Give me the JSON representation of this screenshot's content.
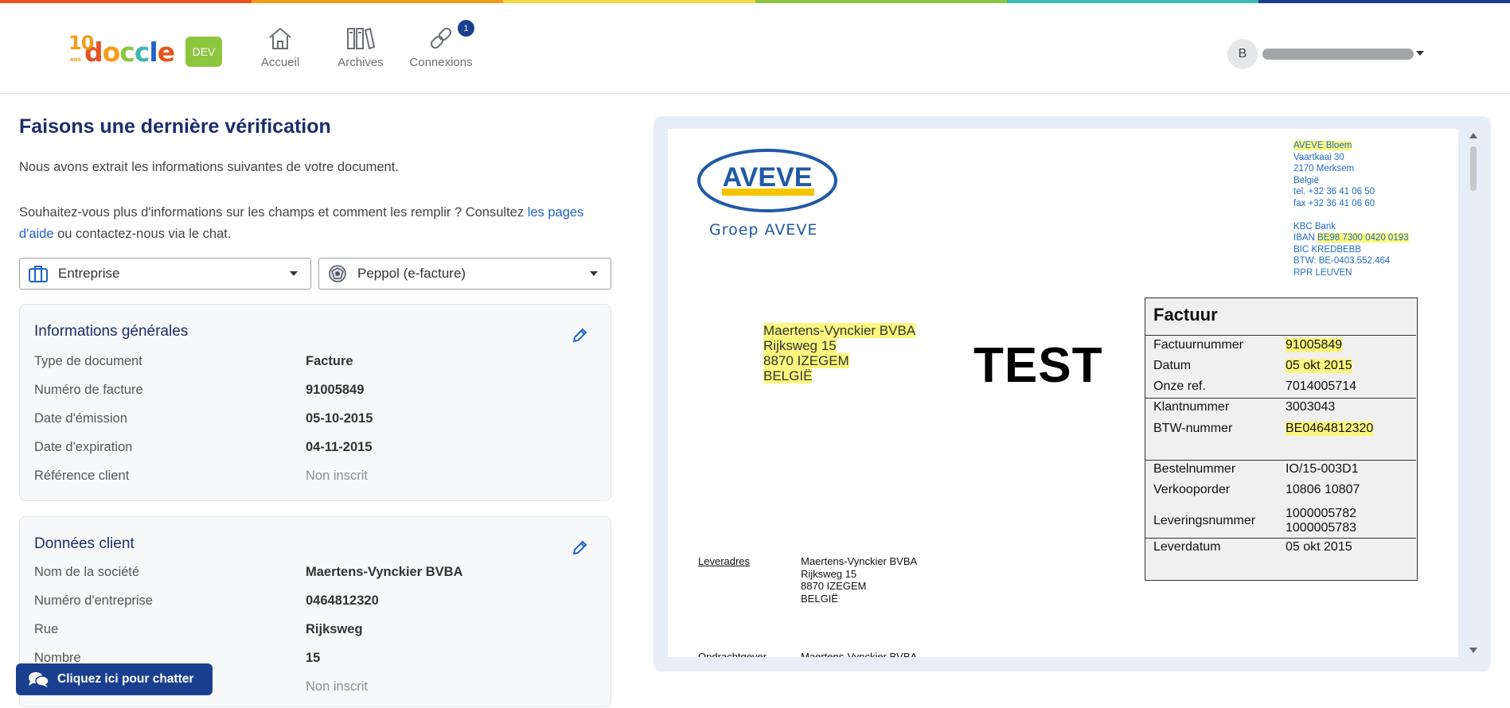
{
  "theme": {
    "rainbow": [
      "#e6531f",
      "#f39c1a",
      "#f5d84a",
      "#8cc63f",
      "#3fb8af",
      "#1a3f8f"
    ],
    "primary": "#1a3f8f",
    "link": "#1f63c8",
    "dev_badge": "#8cc63f",
    "highlight": "#fbf77e"
  },
  "header": {
    "logo_text": "doccle",
    "logo_years": "10",
    "logo_ans": "ANS",
    "env_badge": "DEV",
    "nav": [
      {
        "label": "Accueil",
        "icon": "home-icon"
      },
      {
        "label": "Archives",
        "icon": "archive-binders-icon"
      },
      {
        "label": "Connexions",
        "icon": "link-icon",
        "badge": "1"
      }
    ],
    "user_initial": "B"
  },
  "main": {
    "title": "Faisons une dernière vérification",
    "intro": "Nous avons extrait les informations suivantes de votre document.",
    "help_before": "Souhaitez-vous plus d'informations sur les champs et comment les remplir ? Consultez ",
    "help_link": "les pages d'aide",
    "help_after": " ou contactez-nous via le chat.",
    "selects": [
      {
        "value": "Entreprise",
        "icon": "briefcase-icon"
      },
      {
        "value": "Peppol (e-facture)",
        "icon": "peppol-icon"
      }
    ]
  },
  "general_info": {
    "title": "Informations générales",
    "rows": [
      {
        "label": "Type de document",
        "value": "Facture"
      },
      {
        "label": "Numéro de facture",
        "value": "91005849"
      },
      {
        "label": "Date d'émission",
        "value": "05-10-2015"
      },
      {
        "label": "Date d'expiration",
        "value": "04-11-2015"
      },
      {
        "label": "Référence client",
        "value": "Non inscrit"
      }
    ]
  },
  "client_data": {
    "title": "Données client",
    "rows": [
      {
        "label": "Nom de la société",
        "value": "Maertens-Vynckier BVBA"
      },
      {
        "label": "Numéro d'entreprise",
        "value": "0464812320"
      },
      {
        "label": "Rue",
        "value": "Rijksweg"
      },
      {
        "label": "Nombre",
        "value": "15"
      },
      {
        "label": "",
        "value": "Non inscrit"
      }
    ]
  },
  "chat": {
    "label": "Cliquez ici pour chatter"
  },
  "document": {
    "logo_text": "AVEVE",
    "group_text": "Groep AVEVE",
    "sender": {
      "name": "AVEVE Bloem",
      "street": "Vaartkaai 30",
      "city": "2170 Merksem",
      "country": "België",
      "tel": "tel. +32 36 41 06 50",
      "fax": "fax +32 36 41 06 60",
      "bank": "KBC Bank",
      "iban_label": "IBAN",
      "iban": "BE98 7300 0420 0193",
      "bic": "BIC KREDBEBB",
      "btw": "BTW: BE-0403.552.464",
      "rpr": "RPR LEUVEN"
    },
    "customer": [
      "Maertens-Vynckier BVBA",
      "Rijksweg 15",
      "8870 IZEGEM",
      "BELGIË"
    ],
    "watermark": "TEST",
    "invoice": {
      "title": "Factuur",
      "rows": [
        {
          "k": "Factuurnummer",
          "v": "91005849",
          "hl": true
        },
        {
          "k": "Datum",
          "v": "05 okt 2015",
          "hl": true
        },
        {
          "k": "Onze ref.",
          "v": "7014005714"
        },
        {
          "k": "Klantnummer",
          "v": "3003043"
        },
        {
          "k": "BTW-nummer",
          "v": "BE0464812320",
          "hl": true
        },
        {
          "k": "Bestelnummer",
          "v": "IO/15-003D1"
        },
        {
          "k": "Verkooporder",
          "v": "10806 10807"
        },
        {
          "k": "Leveringsnummer",
          "v": "1000005782",
          "v2": "1000005783"
        },
        {
          "k": "Leverdatum",
          "v": "05 okt 2015"
        }
      ]
    },
    "delivery_label": "Leveradres",
    "delivery": [
      "Maertens-Vynckier BVBA",
      "Rijksweg 15",
      "8870 IZEGEM",
      "BELGIË"
    ],
    "cut_label": "Opdrachtgever",
    "cut_value": "Maertens-Vynckier BVBA"
  }
}
